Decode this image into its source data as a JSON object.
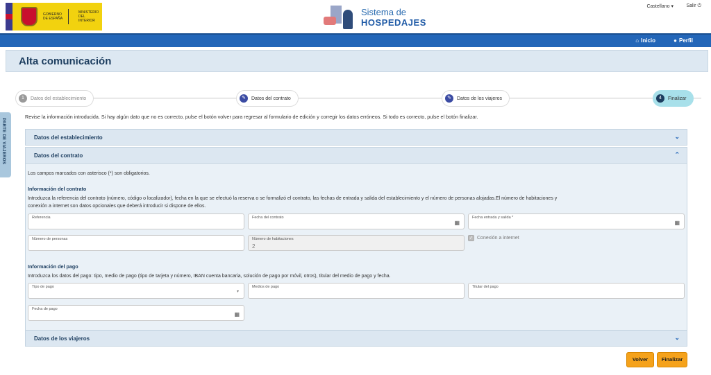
{
  "header": {
    "gov_line1": "Gobierno de España",
    "gov_line2": "Ministerio del Interior",
    "app_title_line1": "Sistema de",
    "app_title_line2": "HOSPEDAJES",
    "language": "Castellano",
    "logout": "Salir"
  },
  "nav": {
    "home": "Inicio",
    "profile": "Perfil"
  },
  "page": {
    "title": "Alta comunicación"
  },
  "side_tab": "PARTE DE VIAJEROS",
  "steps": [
    {
      "num": "1",
      "label": "Datos del establecimiento"
    },
    {
      "label": "Datos del contrato"
    },
    {
      "label": "Datos de los viajeros"
    },
    {
      "num": "4",
      "label": "Finalizar"
    }
  ],
  "intro": "Revise la información introducida. Si hay algún dato que no es correcto, pulse el botón volver para regresar al formulario de edición y corregir los datos erróneos. Si todo es correcto, pulse el botón finalizar.",
  "sections": {
    "establishment": "Datos del establecimiento",
    "contract": "Datos del contrato",
    "travelers": "Datos de los viajeros"
  },
  "contract": {
    "required_note": "Los campos marcados con asterisco (*) son obligatorios.",
    "info_title": "Información del contrato",
    "info_text_1": "Introduzca la referencia del contrato (número, código o localizador), fecha en la que se efectuó la reserva o se formalizó el contrato, las fechas de entrada y salida del establecimiento y el número de personas alojadas.El número de habitaciones y",
    "info_text_2": "conexión a internet son datos opcionales que deberá introducir si dispone de ellos.",
    "reference_label": "Referencia",
    "contract_date_label": "Fecha del contrato",
    "checkin_label": "Fecha entrada y salida *",
    "persons_label": "Número de personas",
    "rooms_label": "Número de habitaciones",
    "rooms_value": "2",
    "internet_label": "Conexión a internet",
    "payment_title": "Información del pago",
    "payment_text": "Introduzca los datos del pago: tipo, medio de pago (tipo de tarjeta y número, IBAN cuenta bancaria, solución de pago por móvil, otros), titular del medio de pago y fecha.",
    "payment_type_label": "Tipo de pago",
    "payment_means_label": "Medios de pago",
    "payment_holder_label": "Titular del pago",
    "payment_date_label": "Fecha de pago"
  },
  "buttons": {
    "back": "Volver",
    "finish": "Finalizar"
  },
  "colors": {
    "navbar": "#2366b8",
    "accent": "#f5a21b",
    "active_step": "#a8e0ea"
  }
}
